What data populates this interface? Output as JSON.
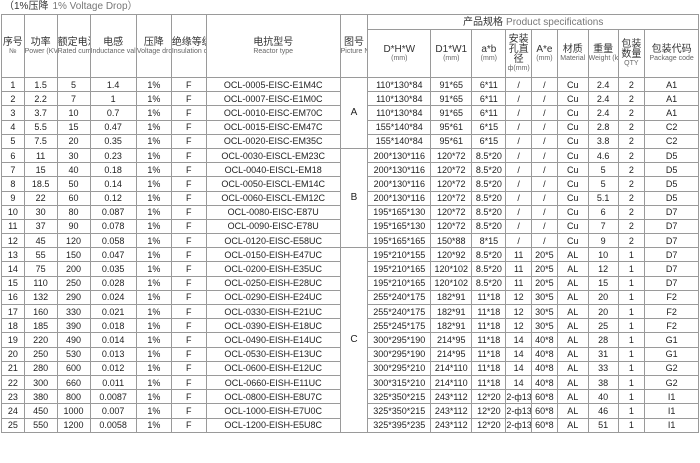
{
  "caption": {
    "cn": "（1%压降",
    "en": "1% Voltage Drop）"
  },
  "headers": {
    "no": {
      "cn": "序号",
      "en": "№"
    },
    "power": {
      "cn": "功率",
      "en": "Power (KVA)"
    },
    "current": {
      "cn": "额定电流",
      "en": "Rated current (A)"
    },
    "inductance": {
      "cn": "电感",
      "en": "Inductance value (mH)"
    },
    "drop": {
      "cn": "压降",
      "en": "Voltage drop"
    },
    "insulation": {
      "cn": "绝缘等级",
      "en": "Insulation class"
    },
    "model": {
      "cn": "电抗型号",
      "en": "Reactor type"
    },
    "picture": {
      "cn": "图号",
      "en": "Picture No."
    },
    "spec_group": {
      "cn": "产品规格",
      "en": "Product specifications"
    },
    "dhw": {
      "cn": "D*H*W",
      "en": "(mm)"
    },
    "d1w1": {
      "cn": "D1*W1",
      "en": "(mm)"
    },
    "ab": {
      "cn": "a*b",
      "en": "(mm)"
    },
    "hole": {
      "cn": "安装孔直径",
      "en": "ф(mm)"
    },
    "ae": {
      "cn": "A*e",
      "en": "(mm)"
    },
    "material": {
      "cn": "材质",
      "en": "Material"
    },
    "weight": {
      "cn": "重量",
      "en": "Weight (kg)"
    },
    "qty": {
      "cn": "包装数量",
      "en": "QTY"
    },
    "package": {
      "cn": "包装代码",
      "en": "Package code"
    }
  },
  "picture_groups": [
    "A",
    "B",
    "C"
  ],
  "rows": [
    [
      "1",
      "1.5",
      "5",
      "1.4",
      "1%",
      "F",
      "OCL-0005-EISC-E1M4C",
      "110*130*84",
      "91*65",
      "6*11",
      "/",
      "/",
      "Cu",
      "2.4",
      "2",
      "A1"
    ],
    [
      "2",
      "2.2",
      "7",
      "1",
      "1%",
      "F",
      "OCL-0007-EISC-E1M0C",
      "110*130*84",
      "91*65",
      "6*11",
      "/",
      "/",
      "Cu",
      "2.4",
      "2",
      "A1"
    ],
    [
      "3",
      "3.7",
      "10",
      "0.7",
      "1%",
      "F",
      "OCL-0010-EISC-EM70C",
      "110*130*84",
      "91*65",
      "6*11",
      "/",
      "/",
      "Cu",
      "2.4",
      "2",
      "A1"
    ],
    [
      "4",
      "5.5",
      "15",
      "0.47",
      "1%",
      "F",
      "OCL-0015-EISC-EM47C",
      "155*140*84",
      "95*61",
      "6*15",
      "/",
      "/",
      "Cu",
      "2.8",
      "2",
      "C2"
    ],
    [
      "5",
      "7.5",
      "20",
      "0.35",
      "1%",
      "F",
      "OCL-0020-EISC-EM35C",
      "155*140*84",
      "95*61",
      "6*15",
      "/",
      "/",
      "Cu",
      "3.8",
      "2",
      "C2"
    ],
    [
      "6",
      "11",
      "30",
      "0.23",
      "1%",
      "F",
      "OCL-0030-EISCL-EM23C",
      "200*130*116",
      "120*72",
      "8.5*20",
      "/",
      "/",
      "Cu",
      "4.6",
      "2",
      "D5"
    ],
    [
      "7",
      "15",
      "40",
      "0.18",
      "1%",
      "F",
      "OCL-0040-EISCL-EM18",
      "200*130*116",
      "120*72",
      "8.5*20",
      "/",
      "/",
      "Cu",
      "5",
      "2",
      "D5"
    ],
    [
      "8",
      "18.5",
      "50",
      "0.14",
      "1%",
      "F",
      "OCL-0050-EISCL-EM14C",
      "200*130*116",
      "120*72",
      "8.5*20",
      "/",
      "/",
      "Cu",
      "5",
      "2",
      "D5"
    ],
    [
      "9",
      "22",
      "60",
      "0.12",
      "1%",
      "F",
      "OCL-0060-EISCL-EM12C",
      "200*130*116",
      "120*72",
      "8.5*20",
      "/",
      "/",
      "Cu",
      "5.1",
      "2",
      "D5"
    ],
    [
      "10",
      "30",
      "80",
      "0.087",
      "1%",
      "F",
      "OCL-0080-EISC-E87U",
      "195*165*130",
      "120*72",
      "8.5*20",
      "/",
      "/",
      "Cu",
      "6",
      "2",
      "D7"
    ],
    [
      "11",
      "37",
      "90",
      "0.078",
      "1%",
      "F",
      "OCL-0090-EISC-E78U",
      "195*165*130",
      "120*72",
      "8.5*20",
      "/",
      "/",
      "Cu",
      "7",
      "2",
      "D7"
    ],
    [
      "12",
      "45",
      "120",
      "0.058",
      "1%",
      "F",
      "OCL-0120-EISC-E58UC",
      "195*165*165",
      "150*88",
      "8*15",
      "/",
      "/",
      "Cu",
      "9",
      "2",
      "D7"
    ],
    [
      "13",
      "55",
      "150",
      "0.047",
      "1%",
      "F",
      "OCL-0150-EISH-E47UC",
      "195*210*155",
      "120*92",
      "8.5*20",
      "11",
      "20*5",
      "AL",
      "10",
      "1",
      "D7"
    ],
    [
      "14",
      "75",
      "200",
      "0.035",
      "1%",
      "F",
      "OCL-0200-EISH-E35UC",
      "195*210*165",
      "120*102",
      "8.5*20",
      "11",
      "20*5",
      "AL",
      "12",
      "1",
      "D7"
    ],
    [
      "15",
      "110",
      "250",
      "0.028",
      "1%",
      "F",
      "OCL-0250-EISH-E28UC",
      "195*210*165",
      "120*102",
      "8.5*20",
      "11",
      "20*5",
      "AL",
      "15",
      "1",
      "D7"
    ],
    [
      "16",
      "132",
      "290",
      "0.024",
      "1%",
      "F",
      "OCL-0290-EISH-E24UC",
      "255*240*175",
      "182*91",
      "11*18",
      "12",
      "30*5",
      "AL",
      "20",
      "1",
      "F2"
    ],
    [
      "17",
      "160",
      "330",
      "0.021",
      "1%",
      "F",
      "OCL-0330-EISH-E21UC",
      "255*240*175",
      "182*91",
      "11*18",
      "12",
      "30*5",
      "AL",
      "20",
      "1",
      "F2"
    ],
    [
      "18",
      "185",
      "390",
      "0.018",
      "1%",
      "F",
      "OCL-0390-EISH-E18UC",
      "255*245*175",
      "182*91",
      "11*18",
      "12",
      "30*5",
      "AL",
      "25",
      "1",
      "F2"
    ],
    [
      "19",
      "220",
      "490",
      "0.014",
      "1%",
      "F",
      "OCL-0490-EISH-E14UC",
      "300*295*190",
      "214*95",
      "11*18",
      "14",
      "40*8",
      "AL",
      "28",
      "1",
      "G1"
    ],
    [
      "20",
      "250",
      "530",
      "0.013",
      "1%",
      "F",
      "OCL-0530-EISH-E13UC",
      "300*295*190",
      "214*95",
      "11*18",
      "14",
      "40*8",
      "AL",
      "31",
      "1",
      "G1"
    ],
    [
      "21",
      "280",
      "600",
      "0.012",
      "1%",
      "F",
      "OCL-0600-EISH-E12UC",
      "300*295*210",
      "214*110",
      "11*18",
      "14",
      "40*8",
      "AL",
      "33",
      "1",
      "G2"
    ],
    [
      "22",
      "300",
      "660",
      "0.011",
      "1%",
      "F",
      "OCL-0660-EISH-E11UC",
      "300*315*210",
      "214*110",
      "11*18",
      "14",
      "40*8",
      "AL",
      "38",
      "1",
      "G2"
    ],
    [
      "23",
      "380",
      "800",
      "0.0087",
      "1%",
      "F",
      "OCL-0800-EISH-E8U7C",
      "325*350*215",
      "243*112",
      "12*20",
      "2-ф13",
      "60*8",
      "AL",
      "40",
      "1",
      "I1"
    ],
    [
      "24",
      "450",
      "1000",
      "0.007",
      "1%",
      "F",
      "OCL-1000-EISH-E7U0C",
      "325*350*215",
      "243*112",
      "12*20",
      "2-ф13",
      "60*8",
      "AL",
      "46",
      "1",
      "I1"
    ],
    [
      "25",
      "550",
      "1200",
      "0.0058",
      "1%",
      "F",
      "OCL-1200-EISH-E5U8C",
      "325*395*235",
      "243*112",
      "12*20",
      "2-ф13",
      "60*8",
      "AL",
      "51",
      "1",
      "I1"
    ]
  ]
}
